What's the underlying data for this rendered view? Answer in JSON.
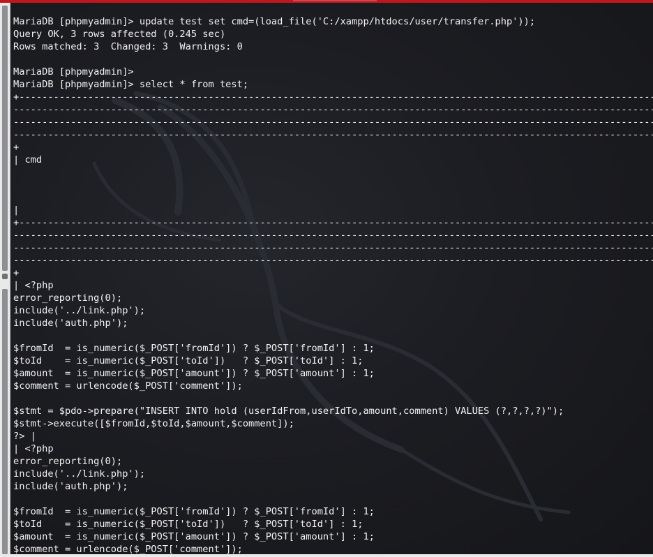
{
  "terminal": {
    "lines": [
      "MariaDB [phpmyadmin]> update test set cmd=(load_file('C:/xampp/htdocs/user/transfer.php'));",
      "Query OK, 3 rows affected (0.245 sec)",
      "Rows matched: 3  Changed: 3  Warnings: 0",
      "",
      "MariaDB [phpmyadmin]>",
      "MariaDB [phpmyadmin]> select * from test;",
      "+-------------------------------------------------------------------------------------------------------------------------------",
      "-------------------------------------------------------------------------------------------------------------------------------",
      "-------------------------------------------------------------------------------------------------------------------------------",
      "-------------------------------------------------------------------------------------------------------------------------------",
      "+",
      "| cmd",
      "",
      "",
      "",
      "|",
      "+-------------------------------------------------------------------------------------------------------------------------------",
      "-------------------------------------------------------------------------------------------------------------------------------",
      "-------------------------------------------------------------------------------------------------------------------------------",
      "-------------------------------------------------------------------------------------------------------------------------------",
      "+",
      "| <?php",
      "error_reporting(0);",
      "include('../link.php');",
      "include('auth.php');",
      "",
      "$fromId  = is_numeric($_POST['fromId']) ? $_POST['fromId'] : 1;",
      "$toId    = is_numeric($_POST['toId'])   ? $_POST['toId'] : 1;",
      "$amount  = is_numeric($_POST['amount']) ? $_POST['amount'] : 1;",
      "$comment = urlencode($_POST['comment']);",
      "",
      "$stmt = $pdo->prepare(\"INSERT INTO hold (userIdFrom,userIdTo,amount,comment) VALUES (?,?,?,?)\");",
      "$stmt->execute([$fromId,$toId,$amount,$comment]);",
      "?> |",
      "| <?php",
      "error_reporting(0);",
      "include('../link.php');",
      "include('auth.php');",
      "",
      "$fromId  = is_numeric($_POST['fromId']) ? $_POST['fromId'] : 1;",
      "$toId    = is_numeric($_POST['toId'])   ? $_POST['toId'] : 1;",
      "$amount  = is_numeric($_POST['amount']) ? $_POST['amount'] : 1;",
      "$comment = urlencode($_POST['comment']);"
    ]
  },
  "colors": {
    "background": "#16171b",
    "text": "#f2f2f2",
    "title_bar_accent": "#c0161c",
    "gutter": "#e9e9ea"
  },
  "icons": {
    "background_watermark": "kali-dragon-icon"
  }
}
